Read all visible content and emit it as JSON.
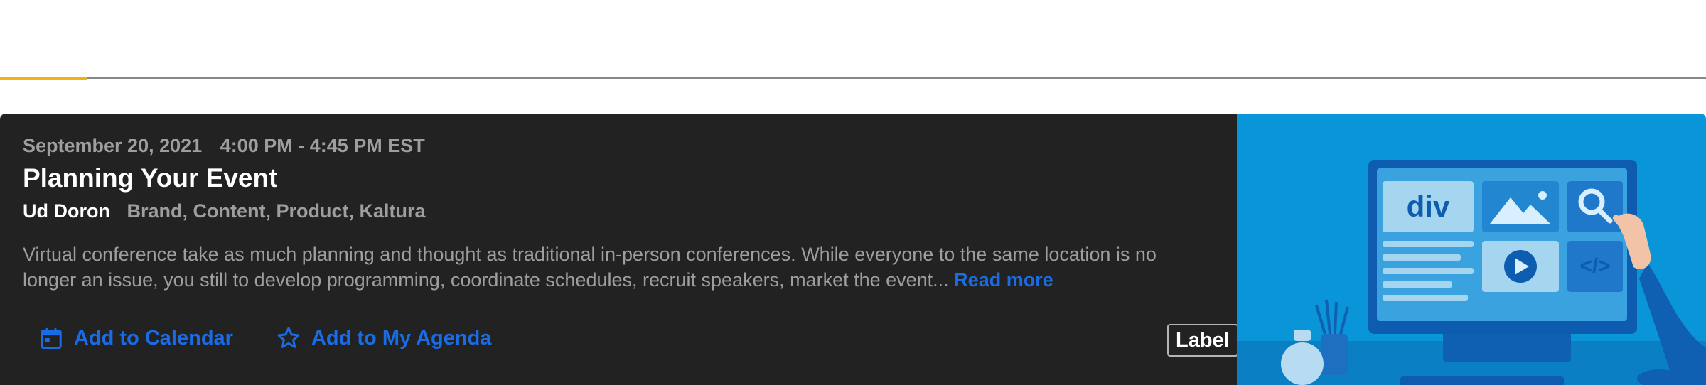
{
  "colors": {
    "accent": "#f2b20f",
    "link": "#1a6ce6",
    "card_background": "#222222",
    "muted_text": "#9e9e9e"
  },
  "session": {
    "date": "September 20, 2021",
    "time": "4:00 PM - 4:45 PM EST",
    "title": "Planning Your Event",
    "presenter_name": "Ud Doron",
    "presenter_orgs": "Brand, Content, Product, Kaltura",
    "description": "Virtual conference take as much planning and thought as traditional in-person conferences. While everyone to the same location is no longer an issue, you still to develop programming, coordinate schedules, recruit speakers, market the event...",
    "read_more": "Read more",
    "label": "Label"
  },
  "actions": {
    "add_to_calendar": {
      "label": "Add to Calendar",
      "icon": "calendar-icon"
    },
    "add_to_agenda": {
      "label": "Add to My Agenda",
      "icon": "star-outline-icon"
    }
  },
  "thumbnail": {
    "div_text": "div",
    "code_text": "</>"
  }
}
